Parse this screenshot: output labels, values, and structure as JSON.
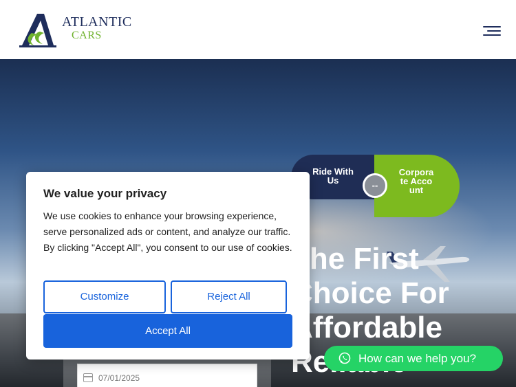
{
  "header": {
    "logo_line1": "ATLANTIC",
    "logo_line2": "CARS"
  },
  "hero": {
    "tab_ride": "Ride With Us",
    "tab_corporate": "Corporate Account",
    "tab_separator": "--",
    "heading": "The First Choice For Affordable Reliable",
    "date_value": "07/01/2025"
  },
  "cookie": {
    "title": "We value your privacy",
    "text": "We use cookies to enhance your browsing experience, serve personalized ads or content, and analyze our traffic. By clicking \"Accept All\", you consent to our use of cookies.",
    "customize": "Customize",
    "reject": "Reject All",
    "accept": "Accept All"
  },
  "whatsapp": {
    "label": "How can we help you?"
  },
  "colors": {
    "brand_navy": "#1f2d55",
    "brand_green": "#7dba1f",
    "cookie_blue": "#1863dc",
    "whatsapp_green": "#25d366"
  }
}
